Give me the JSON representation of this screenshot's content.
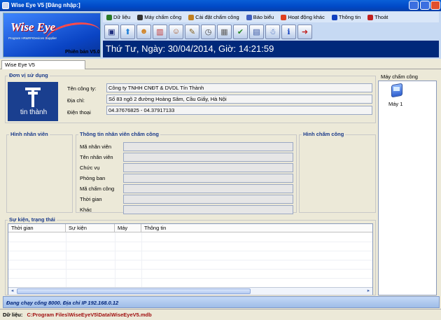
{
  "window": {
    "title": "Wise Eye V5 [Đăng nhập:]"
  },
  "logo": {
    "brand": "Wise Eye",
    "tagline": "Program HR&RFIDevices Supplier",
    "version": "Phiên bản V5.0"
  },
  "menu": {
    "items": [
      {
        "label": "Dữ liệu",
        "icon": "database-icon",
        "color": "#2a7a2a"
      },
      {
        "label": "Máy chấm công",
        "icon": "machine-icon",
        "color": "#333333"
      },
      {
        "label": "Cài đặt chấm công",
        "icon": "settings-icon",
        "color": "#c08020"
      },
      {
        "label": "Báo biểu",
        "icon": "report-icon",
        "color": "#4060c0"
      },
      {
        "label": "Hoạt động khác",
        "icon": "activity-icon",
        "color": "#e04020"
      },
      {
        "label": "Thông tin",
        "icon": "info-icon",
        "color": "#1040c0"
      },
      {
        "label": "Thoát",
        "icon": "exit-icon",
        "color": "#c02020"
      }
    ]
  },
  "toolbar": {
    "icons": [
      {
        "name": "save-icon",
        "glyph": "▣",
        "color": "#203080"
      },
      {
        "name": "upload-icon",
        "glyph": "⬆",
        "color": "#1f7fd8"
      },
      {
        "name": "employee-icon",
        "glyph": "☻",
        "color": "#d08020"
      },
      {
        "name": "chart-icon",
        "glyph": "▥",
        "color": "#c03030"
      },
      {
        "name": "group-icon",
        "glyph": "☺",
        "color": "#a05020"
      },
      {
        "name": "edit-icon",
        "glyph": "✎",
        "color": "#806020"
      },
      {
        "name": "clock-icon",
        "glyph": "◷",
        "color": "#404040"
      },
      {
        "name": "calendar-icon",
        "glyph": "▦",
        "color": "#606060"
      },
      {
        "name": "check-icon",
        "glyph": "✔",
        "color": "#2a8a2a"
      },
      {
        "name": "document-icon",
        "glyph": "▤",
        "color": "#3050a0"
      },
      {
        "name": "user-info-icon",
        "glyph": "☃",
        "color": "#2050b0"
      },
      {
        "name": "info-icon",
        "glyph": "ℹ",
        "color": "#1040c0"
      },
      {
        "name": "exit-icon",
        "glyph": "➜",
        "color": "#c02020"
      }
    ]
  },
  "datebar": {
    "text": "Thứ Tư, Ngày: 30/04/2014, Giờ: 14:21:59"
  },
  "tabs": {
    "active": "Wise Eye V5"
  },
  "company": {
    "section_title": "Đơn vị sử dụng",
    "logo_text": "tin thành",
    "name_label": "Tên công ty:",
    "name_value": "Công ty TNHH CNĐT & DVDL Tín Thành",
    "address_label": "Địa chỉ:",
    "address_value": "Số 83 ngõ 2 đường Hoàng Sâm, Cầu Giấy, Hà Nội",
    "phone_label": "Điện thoại",
    "phone_value": "04.37676825 - 04.37917133"
  },
  "employee": {
    "photo_title": "Hình nhân viên",
    "info_title": "Thông tin nhân viên chấm công",
    "attend_photo_title": "Hình chấm công",
    "fields": [
      {
        "label": "Mã nhân viên",
        "value": ""
      },
      {
        "label": "Tên nhân viên",
        "value": ""
      },
      {
        "label": "Chức vụ",
        "value": ""
      },
      {
        "label": "Phòng ban",
        "value": ""
      },
      {
        "label": "Mã chấm công",
        "value": ""
      },
      {
        "label": "Thời gian",
        "value": ""
      },
      {
        "label": "Khác",
        "value": ""
      }
    ]
  },
  "events": {
    "section_title": "Sự kiện, trạng thái",
    "columns": [
      "Thời gian",
      "Sự kiện",
      "Máy",
      "Thông tin"
    ],
    "rows": []
  },
  "machines": {
    "panel_title": "Máy chấm công",
    "items": [
      {
        "label": "Máy 1",
        "icon": "attendance-machine-icon"
      }
    ]
  },
  "status": {
    "connection": "Đang chạy cổng 8000. Địa chỉ IP 192.168.0.12",
    "db_label": "Dữ liệu:",
    "db_path": "C:Program Files\\WiseEyeV5\\Data\\WiseEyeV5.mdb"
  }
}
